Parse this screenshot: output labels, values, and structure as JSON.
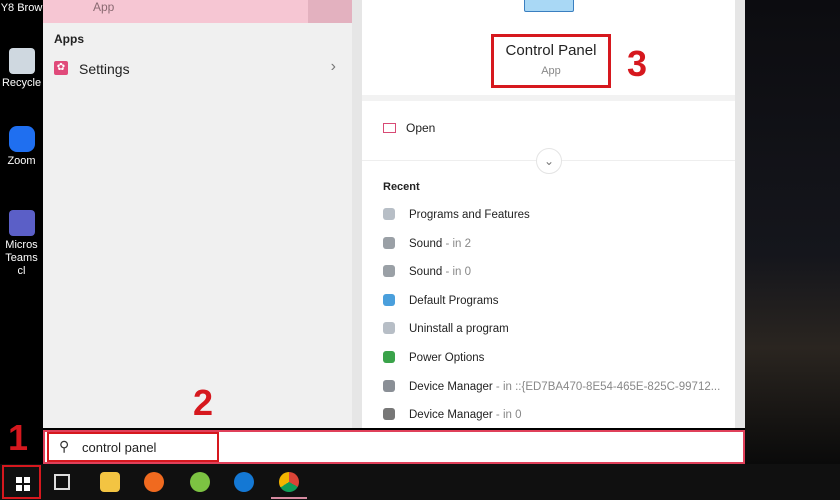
{
  "desktop": {
    "icons": [
      {
        "label": "Y8 Brow"
      },
      {
        "label": "Recycle"
      },
      {
        "label": "Zoom"
      },
      {
        "label": "Micros Teams cl"
      }
    ]
  },
  "start_menu": {
    "best_match": {
      "subtitle": "App"
    },
    "apps_section": "Apps",
    "apps": [
      {
        "label": "Settings",
        "icon": "gear-icon"
      }
    ],
    "details": {
      "title": "Control Panel",
      "subtitle": "App",
      "open_label": "Open",
      "recent_label": "Recent",
      "recent": [
        {
          "name": "Programs and Features",
          "loc": ""
        },
        {
          "name": "Sound",
          "loc": " - in 2"
        },
        {
          "name": "Sound",
          "loc": " - in 0"
        },
        {
          "name": "Default Programs",
          "loc": ""
        },
        {
          "name": "Uninstall a program",
          "loc": ""
        },
        {
          "name": "Power Options",
          "loc": ""
        },
        {
          "name": "Device Manager",
          "loc": " - in ::{ED7BA470-8E54-465E-825C-99712..."
        },
        {
          "name": "Device Manager",
          "loc": " - in 0"
        }
      ]
    }
  },
  "search": {
    "value": "control panel",
    "icon": "search-icon"
  },
  "annotations": {
    "one": "1",
    "two": "2",
    "three": "3"
  },
  "taskbar": {
    "items": [
      "start",
      "task-view",
      "file-explorer",
      "firefox",
      "coc-coc",
      "edge",
      "chrome"
    ]
  },
  "colors": {
    "annotation": "#d6181e",
    "accent": "#e04a7a"
  }
}
